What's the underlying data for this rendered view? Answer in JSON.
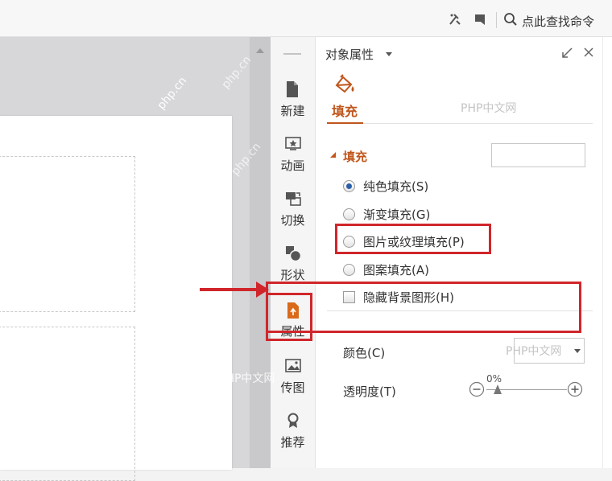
{
  "topbar": {
    "search_text": "点此查找命令",
    "icons": [
      "tools-icon",
      "flag-icon",
      "search-icon"
    ]
  },
  "toolstrip": {
    "items": [
      {
        "label": "新建",
        "icon": "new-page-icon"
      },
      {
        "label": "动画",
        "icon": "animation-icon"
      },
      {
        "label": "切换",
        "icon": "transition-icon"
      },
      {
        "label": "形状",
        "icon": "shape-icon"
      },
      {
        "label": "属性",
        "icon": "properties-icon",
        "active": true
      },
      {
        "label": "传图",
        "icon": "upload-image-icon"
      },
      {
        "label": "推荐",
        "icon": "recommend-icon"
      }
    ]
  },
  "panel": {
    "title": "对象属性",
    "tabs": [
      {
        "label": "填充",
        "active": true
      }
    ],
    "section_title": "填充",
    "fill_options": [
      {
        "label": "纯色填充(S)",
        "checked": true
      },
      {
        "label": "渐变填充(G)",
        "checked": false
      },
      {
        "label": "图片或纹理填充(P)",
        "checked": false
      },
      {
        "label": "图案填充(A)",
        "checked": false
      }
    ],
    "hide_background_label": "隐藏背景图形(H)",
    "hide_background_checked": false,
    "color_label": "颜色(C)",
    "opacity_label": "透明度(T)",
    "opacity_value": "0%"
  },
  "watermarks": [
    "PHP中文网",
    "PHP中文网",
    "PHP中文网",
    "PHP中文网",
    "php.cn",
    "php.cn",
    "php.cn"
  ],
  "colors": {
    "accent": "#c0561c",
    "annotation": "#d0262b"
  }
}
